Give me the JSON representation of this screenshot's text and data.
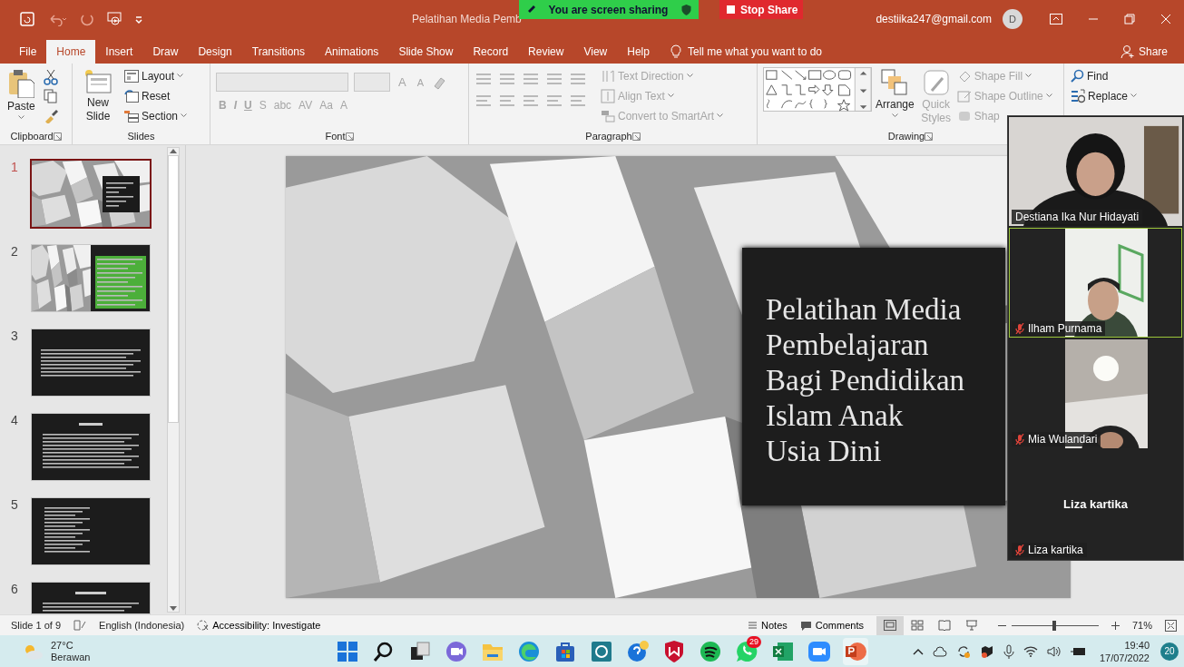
{
  "title_bar": {
    "document_title": "Pelatihan Media Pemb",
    "sharing_banner": "You are screen sharing",
    "stop_share": "Stop Share",
    "account": "destiika247@gmail.com",
    "avatar": "D"
  },
  "ribbon_tabs": [
    {
      "label": "File",
      "selected": false
    },
    {
      "label": "Home",
      "selected": true
    },
    {
      "label": "Insert",
      "selected": false
    },
    {
      "label": "Draw",
      "selected": false
    },
    {
      "label": "Design",
      "selected": false
    },
    {
      "label": "Transitions",
      "selected": false
    },
    {
      "label": "Animations",
      "selected": false
    },
    {
      "label": "Slide Show",
      "selected": false
    },
    {
      "label": "Record",
      "selected": false
    },
    {
      "label": "Review",
      "selected": false
    },
    {
      "label": "View",
      "selected": false
    },
    {
      "label": "Help",
      "selected": false
    }
  ],
  "tell_me": "Tell me what you want to do",
  "share_button": "Share",
  "ribbon_groups": [
    {
      "kind": "clipboard",
      "label": "Clipboard",
      "commands": [
        {
          "label": "Paste",
          "disabled": false
        }
      ]
    },
    {
      "kind": "slides",
      "label": "Slides",
      "commands": [
        {
          "label": "New Slide",
          "disabled": false
        },
        {
          "label": "Layout",
          "disabled": false
        },
        {
          "label": "Reset",
          "disabled": false
        },
        {
          "label": "Section",
          "disabled": false
        }
      ]
    },
    {
      "kind": "font",
      "label": "Font",
      "commands": [
        {
          "label": "A",
          "disabled": true
        },
        {
          "label": "A",
          "disabled": true
        },
        {
          "label": "B",
          "disabled": true
        },
        {
          "label": "I",
          "disabled": true
        },
        {
          "label": "U",
          "disabled": true
        },
        {
          "label": "S",
          "disabled": true
        },
        {
          "label": "abc",
          "disabled": true
        },
        {
          "label": "AV",
          "disabled": true
        },
        {
          "label": "Aa",
          "disabled": true
        },
        {
          "label": "A",
          "disabled": true
        }
      ]
    },
    {
      "kind": "paragraph",
      "label": "Paragraph",
      "commands": [
        {
          "label": "Text Direction",
          "disabled": true
        },
        {
          "label": "Align Text",
          "disabled": true
        },
        {
          "label": "Convert to SmartArt",
          "disabled": true
        }
      ]
    },
    {
      "kind": "drawing",
      "label": "Drawing",
      "commands": [
        {
          "label": "Arrange",
          "disabled": false
        },
        {
          "label": "Quick Styles",
          "disabled": true
        },
        {
          "label": "Shape Fill",
          "disabled": true
        },
        {
          "label": "Shape Outline",
          "disabled": true
        },
        {
          "label": "Shap",
          "disabled": true
        }
      ]
    },
    {
      "kind": "editing",
      "commands": [
        {
          "label": "Find",
          "disabled": false
        },
        {
          "label": "Replace",
          "disabled": false
        }
      ]
    }
  ],
  "thumbnails": [
    {
      "number": "1",
      "kind": "cover",
      "selected": true
    },
    {
      "number": "2",
      "kind": "split",
      "selected": false
    },
    {
      "number": "3",
      "kind": "text",
      "selected": false
    },
    {
      "number": "4",
      "kind": "titled",
      "selected": false
    },
    {
      "number": "5",
      "kind": "list",
      "selected": false
    },
    {
      "number": "6",
      "kind": "titled-cut",
      "selected": false
    }
  ],
  "slide": {
    "title": "Pelatihan Media\nPembelajaran\nBagi Pendidikan\nIslam Anak\nUsia Dini"
  },
  "video_tiles": [
    {
      "name": "Destiana Ika Nur Hidayati",
      "kind": "full",
      "muted": false,
      "speaking": false
    },
    {
      "name": "Ilham Purnama",
      "kind": "portrait",
      "muted": true,
      "speaking": true
    },
    {
      "name": "Mia Wulandari",
      "kind": "portrait",
      "muted": true,
      "speaking": false
    },
    {
      "name": "Liza kartika",
      "kind": "no-video",
      "center_name": "Liza kartika",
      "muted": true,
      "speaking": false
    }
  ],
  "status_bar": {
    "slide_position": "Slide 1 of 9",
    "language": "English (Indonesia)",
    "accessibility": "Accessibility: Investigate",
    "notes": "Notes",
    "comments": "Comments",
    "views": [
      {
        "kind": "normal",
        "selected": true
      },
      {
        "kind": "sorter",
        "selected": false
      },
      {
        "kind": "reading",
        "selected": false
      },
      {
        "kind": "show",
        "selected": false
      }
    ],
    "zoom": {
      "level": 0.47,
      "reading": "71%"
    }
  },
  "taskbar": {
    "temperature": "27°C",
    "weather": "Berawan",
    "apps": [
      {
        "kind": "start",
        "selected": false
      },
      {
        "kind": "search",
        "selected": false
      },
      {
        "kind": "taskview",
        "selected": false
      },
      {
        "kind": "chat",
        "selected": false
      },
      {
        "kind": "folder",
        "selected": false
      },
      {
        "kind": "browser",
        "selected": false
      },
      {
        "kind": "store",
        "selected": false
      },
      {
        "kind": "teal",
        "selected": false
      },
      {
        "kind": "help",
        "selected": false
      },
      {
        "kind": "shield",
        "selected": false
      },
      {
        "kind": "music",
        "selected": false
      },
      {
        "kind": "messenger",
        "selected": false,
        "badge": "29"
      },
      {
        "kind": "sheet",
        "selected": false
      },
      {
        "kind": "camera",
        "selected": false
      },
      {
        "kind": "presentation",
        "selected": true
      }
    ],
    "time": "19:40",
    "date": "17/07/2022",
    "notifications": "20"
  }
}
